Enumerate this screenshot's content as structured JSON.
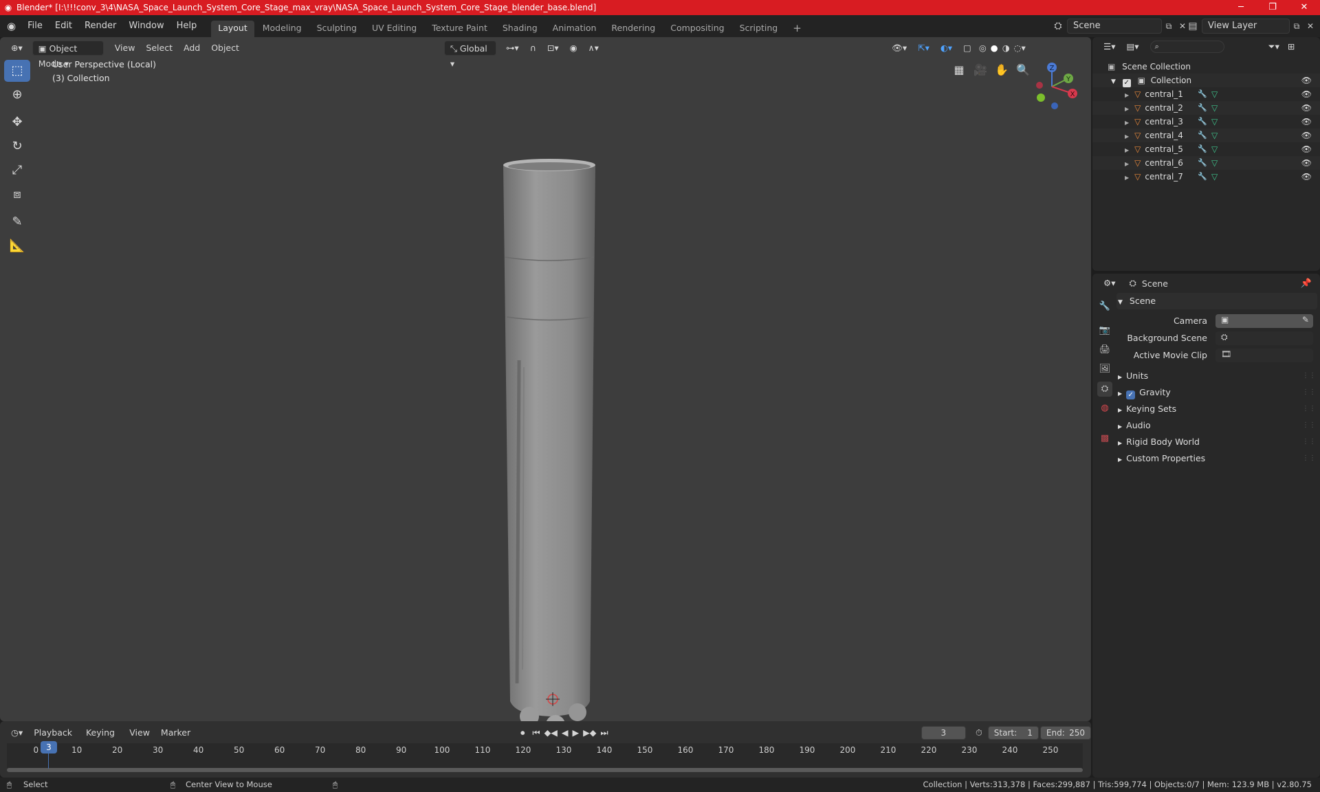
{
  "window": {
    "title": "Blender* [I:\\!!!conv_3\\4\\NASA_Space_Launch_System_Core_Stage_max_vray\\NASA_Space_Launch_System_Core_Stage_blender_base.blend]",
    "minimize": "─",
    "maximize": "❐",
    "close": "✕"
  },
  "menu": [
    "File",
    "Edit",
    "Render",
    "Window",
    "Help"
  ],
  "workspaces": [
    "Layout",
    "Modeling",
    "Sculpting",
    "UV Editing",
    "Texture Paint",
    "Shading",
    "Animation",
    "Rendering",
    "Compositing",
    "Scripting"
  ],
  "workspace_add": "+",
  "scene_selector": {
    "label": "Scene"
  },
  "view_layer_selector": {
    "label": "View Layer"
  },
  "viewport_header": {
    "mode": "Object Mode",
    "menus": [
      "View",
      "Select",
      "Add",
      "Object"
    ],
    "transform_orientation": "Global"
  },
  "viewport": {
    "perspective": "User Perspective (Local)",
    "collection": "(3) Collection"
  },
  "gizmo": {
    "z": "Z",
    "y": "Y",
    "x": "X"
  },
  "outliner": {
    "scene_collection": "Scene Collection",
    "collection": "Collection",
    "objects": [
      "central_1",
      "central_2",
      "central_3",
      "central_4",
      "central_5",
      "central_6",
      "central_7"
    ]
  },
  "properties": {
    "header": "Scene",
    "panel_title": "Scene",
    "camera_label": "Camera",
    "background_scene_label": "Background Scene",
    "active_movie_clip_label": "Active Movie Clip",
    "sections": [
      "Units",
      "Gravity",
      "Keying Sets",
      "Audio",
      "Rigid Body World",
      "Custom Properties"
    ],
    "gravity_checked": true
  },
  "timeline": {
    "menus": [
      "Playback",
      "Keying",
      "View",
      "Marker"
    ],
    "current_frame": "3",
    "start_label": "Start:",
    "start": "1",
    "end_label": "End:",
    "end": "250",
    "ticks": [
      "0",
      "10",
      "20",
      "30",
      "40",
      "50",
      "60",
      "70",
      "80",
      "90",
      "100",
      "110",
      "120",
      "130",
      "140",
      "150",
      "160",
      "170",
      "180",
      "190",
      "200",
      "210",
      "220",
      "230",
      "240",
      "250"
    ],
    "playhead": "3"
  },
  "statusbar": {
    "select": "Select",
    "center_view": "Center View to Mouse",
    "stats": "Collection | Verts:313,378 | Faces:299,887 | Tris:599,774 | Objects:0/7 | Mem: 123.9 MB | v2.80.75"
  },
  "colors": {
    "title_bar": "#d81c22",
    "accent": "#4772b3",
    "object_icon": "#e8883a",
    "mesh_icon": "#3fc48c"
  }
}
